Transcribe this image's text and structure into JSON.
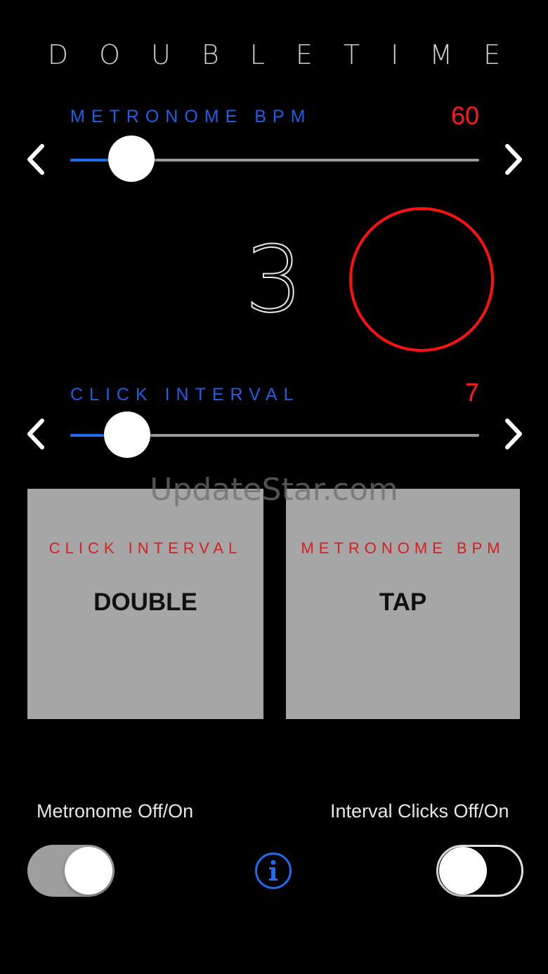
{
  "app": {
    "title": "DOUBLETIME"
  },
  "bpm_slider": {
    "label": "METRONOME BPM",
    "value": "60",
    "fraction": 0.15
  },
  "beat": {
    "count": "3"
  },
  "interval_slider": {
    "label": "CLICK INTERVAL",
    "value": "7",
    "fraction": 0.14
  },
  "pads": {
    "left": {
      "caption": "CLICK INTERVAL",
      "label": "DOUBLE"
    },
    "right": {
      "caption": "METRONOME BPM",
      "label": "TAP"
    }
  },
  "watermark": "UpdateStar.com",
  "toggles": {
    "metronome": {
      "caption": "Metronome Off/On",
      "state": "on"
    },
    "interval_clicks": {
      "caption": "Interval Clicks Off/On",
      "state": "off"
    }
  },
  "colors": {
    "accent_blue": "#1f6cf0",
    "accent_red": "#ff1a1a",
    "pad_gray": "#a6a6a6"
  },
  "icons": {
    "decrease": "chevron-left-icon",
    "increase": "chevron-right-icon",
    "info": "info-circle-icon"
  }
}
